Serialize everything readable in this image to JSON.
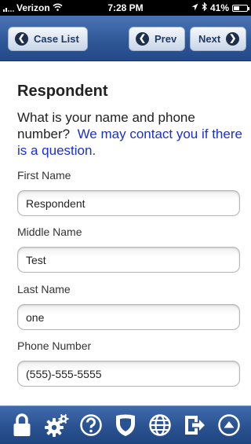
{
  "status_bar": {
    "carrier": "Verizon",
    "time": "7:28 PM",
    "battery_text": "41%",
    "battery_level": 0.41
  },
  "nav": {
    "case_list_label": "Case List",
    "prev_label": "Prev",
    "next_label": "Next"
  },
  "page": {
    "title": "Respondent",
    "question": "What is your name and phone number?",
    "hint": "We may contact you if there is a question."
  },
  "fields": {
    "first_name": {
      "label": "First Name",
      "value": "Respondent"
    },
    "middle_name": {
      "label": "Middle Name",
      "value": "Test"
    },
    "last_name": {
      "label": "Last Name",
      "value": "one"
    },
    "phone": {
      "label": "Phone Number",
      "value": "(555)-555-5555"
    }
  },
  "toolbar": {
    "icons": [
      "lock-icon",
      "gears-icon",
      "help-icon",
      "shield-icon",
      "globe-icon",
      "exit-icon",
      "scroll-up-icon"
    ]
  },
  "colors": {
    "nav_blue": "#2d5694",
    "hint_blue": "#1a2fd6"
  }
}
